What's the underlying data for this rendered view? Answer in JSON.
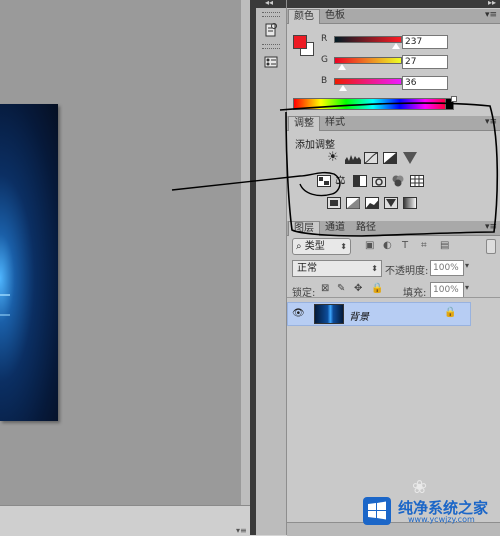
{
  "color_panel": {
    "tabs": [
      "颜色",
      "色板"
    ],
    "active_tab": 0,
    "foreground": "#ed1b24",
    "background": "#ffffff",
    "sliders": [
      {
        "label": "R",
        "value": "237"
      },
      {
        "label": "G",
        "value": "27"
      },
      {
        "label": "B",
        "value": "36"
      }
    ]
  },
  "adjustments_panel": {
    "tabs": [
      "调整",
      "样式"
    ],
    "active_tab": 0,
    "title": "添加调整",
    "rows": [
      [
        "brightness-contrast-icon",
        "levels-icon",
        "curves-icon",
        "exposure-icon",
        "gradient-triangle-icon"
      ],
      [
        "vibrance-icon",
        "color-balance-icon",
        "black-white-icon",
        "photo-filter-icon",
        "channel-mixer-icon",
        "color-lookup-icon"
      ],
      [
        "invert-icon",
        "posterize-icon",
        "threshold-icon",
        "selective-color-icon",
        "gradient-map-icon"
      ]
    ]
  },
  "layers_panel": {
    "tabs": [
      "图层",
      "通道",
      "路径"
    ],
    "active_tab": 0,
    "filter_kind": "类型",
    "blend_mode": "正常",
    "opacity_label": "不透明度:",
    "opacity_value": "100%",
    "lock_label": "锁定:",
    "fill_label": "填充:",
    "fill_value": "100%",
    "layers": [
      {
        "name": "背景",
        "visible": true,
        "locked": true
      }
    ]
  },
  "watermark": {
    "title": "纯净系统之家",
    "url": "www.ycwjzy.com"
  },
  "accent_colors": {
    "selection": "#b7cdf3",
    "annotation": "#000000"
  }
}
